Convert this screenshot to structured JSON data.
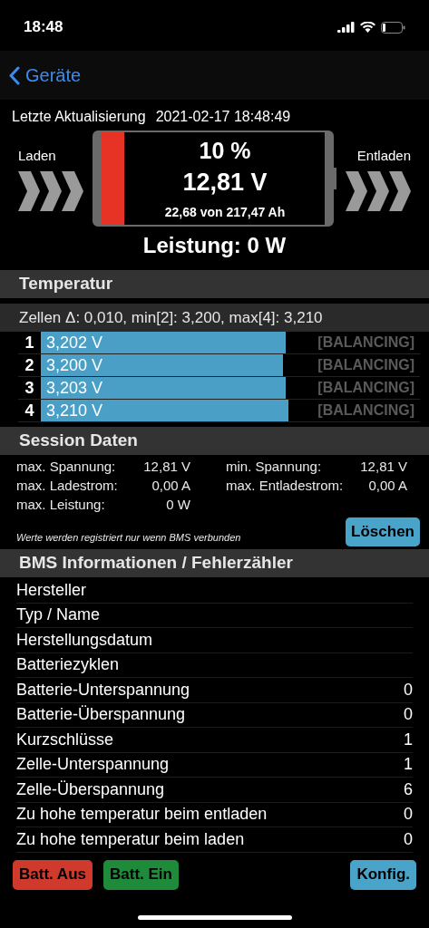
{
  "status_bar": {
    "time": "18:48"
  },
  "nav": {
    "back": "Geräte"
  },
  "update": {
    "label": "Letzte Aktualisierung",
    "value": "2021-02-17 18:48:49"
  },
  "battery": {
    "charge_label": "Laden",
    "discharge_label": "Entladen",
    "percent": "10 %",
    "voltage": "12,81 V",
    "capacity": "22,68 von 217,47 Ah",
    "level": 0.1,
    "power": "Leistung: 0 W"
  },
  "sections": {
    "temperature": "Temperatur",
    "session": "Session Daten",
    "bms": "BMS Informationen / Fehlerzähler"
  },
  "cells_summary": "Zellen Δ: 0,010, min[2]: 3,200, max[4]: 3,210",
  "cells": [
    {
      "index": "1",
      "voltage": "3,202 V",
      "level": 0.646,
      "status": "[BALANCING]",
      "balancing": false
    },
    {
      "index": "2",
      "voltage": "3,200 V",
      "level": 0.639,
      "status": "[BALANCING]",
      "balancing": false
    },
    {
      "index": "3",
      "voltage": "3,203 V",
      "level": 0.646,
      "status": "[BALANCING]",
      "balancing": false
    },
    {
      "index": "4",
      "voltage": "3,210 V",
      "level": 0.653,
      "status": "[BALANCING]",
      "balancing": false
    }
  ],
  "session": {
    "stats": [
      {
        "label": "max. Spannung:",
        "value": "12,81 V"
      },
      {
        "label": "min. Spannung:",
        "value": "12,81 V"
      },
      {
        "label": "max. Ladestrom:",
        "value": "0,00 A"
      },
      {
        "label": "max. Entladestrom:",
        "value": "0,00 A"
      },
      {
        "label": "max. Leistung:",
        "value": "0 W"
      }
    ],
    "note": "Werte werden registriert nur wenn BMS verbunden",
    "clear_button": "Löschen"
  },
  "bms_rows": [
    {
      "label": "Hersteller"
    },
    {
      "label": "Typ / Name"
    },
    {
      "label": "Herstellungsdatum"
    },
    {
      "label": "Batteriezyklen"
    },
    {
      "label": "Batterie-Unterspannung",
      "value": "0"
    },
    {
      "label": "Batterie-Überspannung",
      "value": "0"
    },
    {
      "label": "Kurzschlüsse",
      "value": "1"
    },
    {
      "label": "Zelle-Unterspannung",
      "value": "1"
    },
    {
      "label": "Zelle-Überspannung",
      "value": "6"
    },
    {
      "label": "Zu hohe temperatur beim entladen",
      "value": "0"
    },
    {
      "label": "Zu hohe temperatur beim laden",
      "value": "0"
    }
  ],
  "buttons": [
    {
      "label": "Batt. Aus",
      "color": "#d03a2c"
    },
    {
      "label": "Batt. Ein",
      "color": "#1e8a3a"
    },
    {
      "label": "Konfig.",
      "color": "#4aa3c8"
    }
  ]
}
